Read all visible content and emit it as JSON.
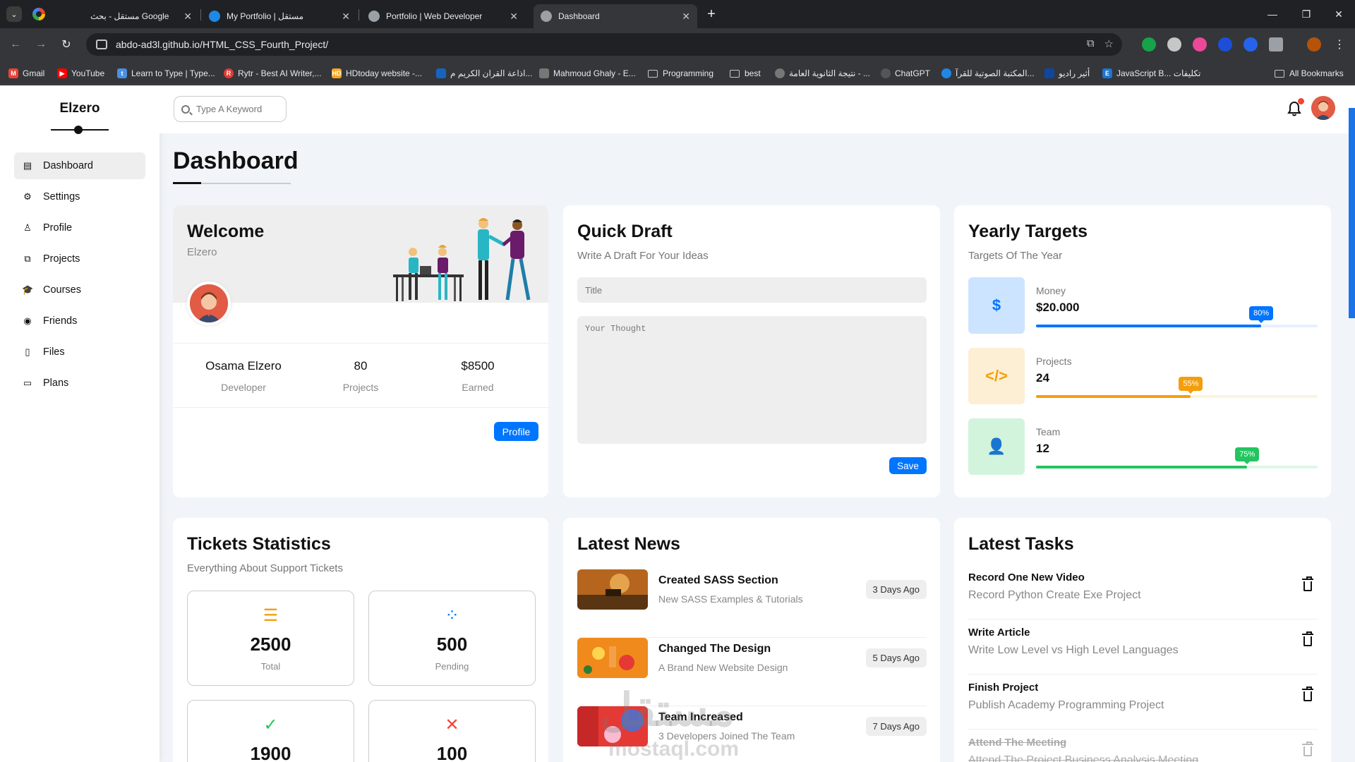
{
  "browser": {
    "tabs": [
      {
        "label": "مستقل - بحث Google",
        "close": "✕"
      },
      {
        "label": "My Portfolio | مستقل",
        "close": "✕"
      },
      {
        "label": "Portfolio | Web Developer",
        "close": "✕"
      },
      {
        "label": "Dashboard",
        "close": "✕"
      }
    ],
    "new_tab": "+",
    "url": "abdo-ad3l.github.io/HTML_CSS_Fourth_Project/",
    "bookmarks": [
      {
        "label": "Gmail",
        "icon": "gmail-icon",
        "color": "#ea4335"
      },
      {
        "label": "YouTube",
        "icon": "youtube-icon",
        "color": "#ff0000"
      },
      {
        "label": "Learn to Type | Type...",
        "icon": "typing-icon",
        "color": "#4a90e2"
      },
      {
        "label": "Rytr - Best AI Writer,...",
        "icon": "rytr-icon",
        "color": "#e53935"
      },
      {
        "label": "HDtoday website -...",
        "icon": "hd-icon",
        "color": "#f5a623"
      },
      {
        "label": "اذاعة القران الكريم م...",
        "icon": "radio-icon",
        "color": "#1565c0"
      },
      {
        "label": "Mahmoud Ghaly - E...",
        "icon": "page-icon",
        "color": "#777777"
      },
      {
        "label": "Programming",
        "icon": "folder-icon",
        "color": ""
      },
      {
        "label": "best",
        "icon": "folder-icon",
        "color": ""
      },
      {
        "label": "نتيجة الثانوية العامة - ...",
        "icon": "globe-icon",
        "color": "#777777"
      },
      {
        "label": "ChatGPT",
        "icon": "chatgpt-icon",
        "color": "#555555"
      },
      {
        "label": "المكتبة الصوتية للقرآ...",
        "icon": "quran-icon",
        "color": "#1e88e5"
      },
      {
        "label": "أثير راديو",
        "icon": "radio-icon",
        "color": "#0d47a1"
      },
      {
        "label": "JavaScript B... تكليفات",
        "icon": "e-icon",
        "color": "#1976d2"
      }
    ],
    "all_bookmarks": "All Bookmarks"
  },
  "sidebar": {
    "brand": "Elzero",
    "items": [
      {
        "label": "Dashboard",
        "icon": "chart-icon",
        "glyph": "▤"
      },
      {
        "label": "Settings",
        "icon": "gear-icon",
        "glyph": "⚙"
      },
      {
        "label": "Profile",
        "icon": "user-icon",
        "glyph": "♙"
      },
      {
        "label": "Projects",
        "icon": "diagram-icon",
        "glyph": "⧉"
      },
      {
        "label": "Courses",
        "icon": "graduation-cap-icon",
        "glyph": "🎓"
      },
      {
        "label": "Friends",
        "icon": "user-circle-icon",
        "glyph": "◉"
      },
      {
        "label": "Files",
        "icon": "file-icon",
        "glyph": "▯"
      },
      {
        "label": "Plans",
        "icon": "credit-card-icon",
        "glyph": "▭"
      }
    ]
  },
  "header": {
    "search_placeholder": "Type A Keyword"
  },
  "page_title": "Dashboard",
  "welcome": {
    "title": "Welcome",
    "subtitle": "Elzero",
    "stats": [
      {
        "value": "Osama Elzero",
        "label": "Developer"
      },
      {
        "value": "80",
        "label": "Projects"
      },
      {
        "value": "$8500",
        "label": "Earned"
      }
    ],
    "button": "Profile"
  },
  "draft": {
    "title": "Quick Draft",
    "subtitle": "Write A Draft For Your Ideas",
    "title_placeholder": "Title",
    "body_placeholder": "Your Thought",
    "button": "Save"
  },
  "targets": {
    "title": "Yearly Targets",
    "subtitle": "Targets Of The Year",
    "items": [
      {
        "label": "Money",
        "value": "$20.000",
        "percent": 80,
        "badge": "80%",
        "icon": "dollar-icon",
        "glyph": "$",
        "color": "#0075ff",
        "bg": "#cce4ff",
        "track": "#e6f0ff"
      },
      {
        "label": "Projects",
        "value": "24",
        "percent": 55,
        "badge": "55%",
        "icon": "code-icon",
        "glyph": "</>",
        "color": "#f59e0b",
        "bg": "#fdefd4",
        "track": "#fdf2dc"
      },
      {
        "label": "Team",
        "value": "12",
        "percent": 75,
        "badge": "75%",
        "icon": "user-icon",
        "glyph": "👤",
        "color": "#22c55e",
        "bg": "#d2f4dd",
        "track": "#def8e6"
      }
    ]
  },
  "tickets": {
    "title": "Tickets Statistics",
    "subtitle": "Everything About Support Tickets",
    "items": [
      {
        "value": "2500",
        "label": "Total",
        "icon": "list-icon",
        "glyph": "☰",
        "color": "#f59e0b"
      },
      {
        "value": "500",
        "label": "Pending",
        "icon": "spinner-icon",
        "glyph": "⁘",
        "color": "#0075ff"
      },
      {
        "value": "1900",
        "label": "",
        "icon": "check-circle-icon",
        "glyph": "✓",
        "color": "#22c55e"
      },
      {
        "value": "100",
        "label": "",
        "icon": "x-square-icon",
        "glyph": "✕",
        "color": "#f44336"
      }
    ]
  },
  "news": {
    "title": "Latest News",
    "items": [
      {
        "title": "Created SASS Section",
        "desc": "New SASS Examples & Tutorials",
        "date": "3 Days Ago"
      },
      {
        "title": "Changed The Design",
        "desc": "A Brand New Website Design",
        "date": "5 Days Ago"
      },
      {
        "title": "Team Increased",
        "desc": "3 Developers Joined The Team",
        "date": "7 Days Ago"
      }
    ]
  },
  "tasks": {
    "title": "Latest Tasks",
    "items": [
      {
        "title": "Record One New Video",
        "desc": "Record Python Create Exe Project",
        "done": false
      },
      {
        "title": "Write Article",
        "desc": "Write Low Level vs High Level Languages",
        "done": false
      },
      {
        "title": "Finish Project",
        "desc": "Publish Academy Programming Project",
        "done": false
      },
      {
        "title": "Attend The Meeting",
        "desc": "Attend The Project Business Analysis Meeting",
        "done": true
      }
    ]
  },
  "watermark": {
    "text": "مستقل",
    "sub": "mostaql.com"
  }
}
